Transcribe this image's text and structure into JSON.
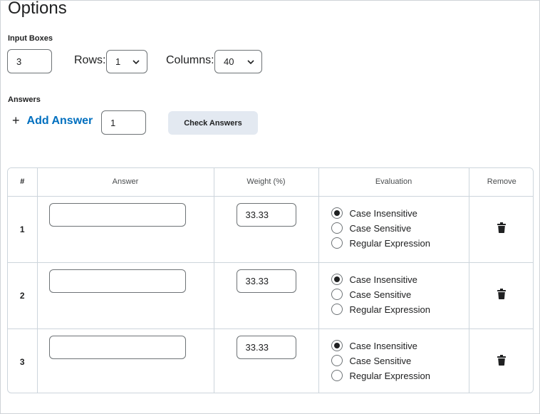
{
  "page": {
    "title": "Options"
  },
  "input_boxes": {
    "label": "Input Boxes",
    "value": "3",
    "rows_label": "Rows:",
    "rows_value": "1",
    "columns_label": "Columns:",
    "columns_value": "40"
  },
  "answers": {
    "label": "Answers",
    "add_label": "Add Answer",
    "add_count": "1",
    "check_label": "Check Answers"
  },
  "table": {
    "headers": {
      "num": "#",
      "answer": "Answer",
      "weight": "Weight (%)",
      "evaluation": "Evaluation",
      "remove": "Remove"
    },
    "evaluation_options": [
      "Case Insensitive",
      "Case Sensitive",
      "Regular Expression"
    ],
    "rows": [
      {
        "num": "1",
        "answer": "",
        "weight": "33.33",
        "evaluation": "Case Insensitive"
      },
      {
        "num": "2",
        "answer": "",
        "weight": "33.33",
        "evaluation": "Case Insensitive"
      },
      {
        "num": "3",
        "answer": "",
        "weight": "33.33",
        "evaluation": "Case Insensitive"
      }
    ]
  },
  "icons": {
    "add": "plus-icon",
    "dropdown": "chevron-down-icon",
    "remove": "trash-icon"
  },
  "colors": {
    "link": "#006fbf",
    "button_bg": "#e3e9f1",
    "border": "#6e7376"
  }
}
